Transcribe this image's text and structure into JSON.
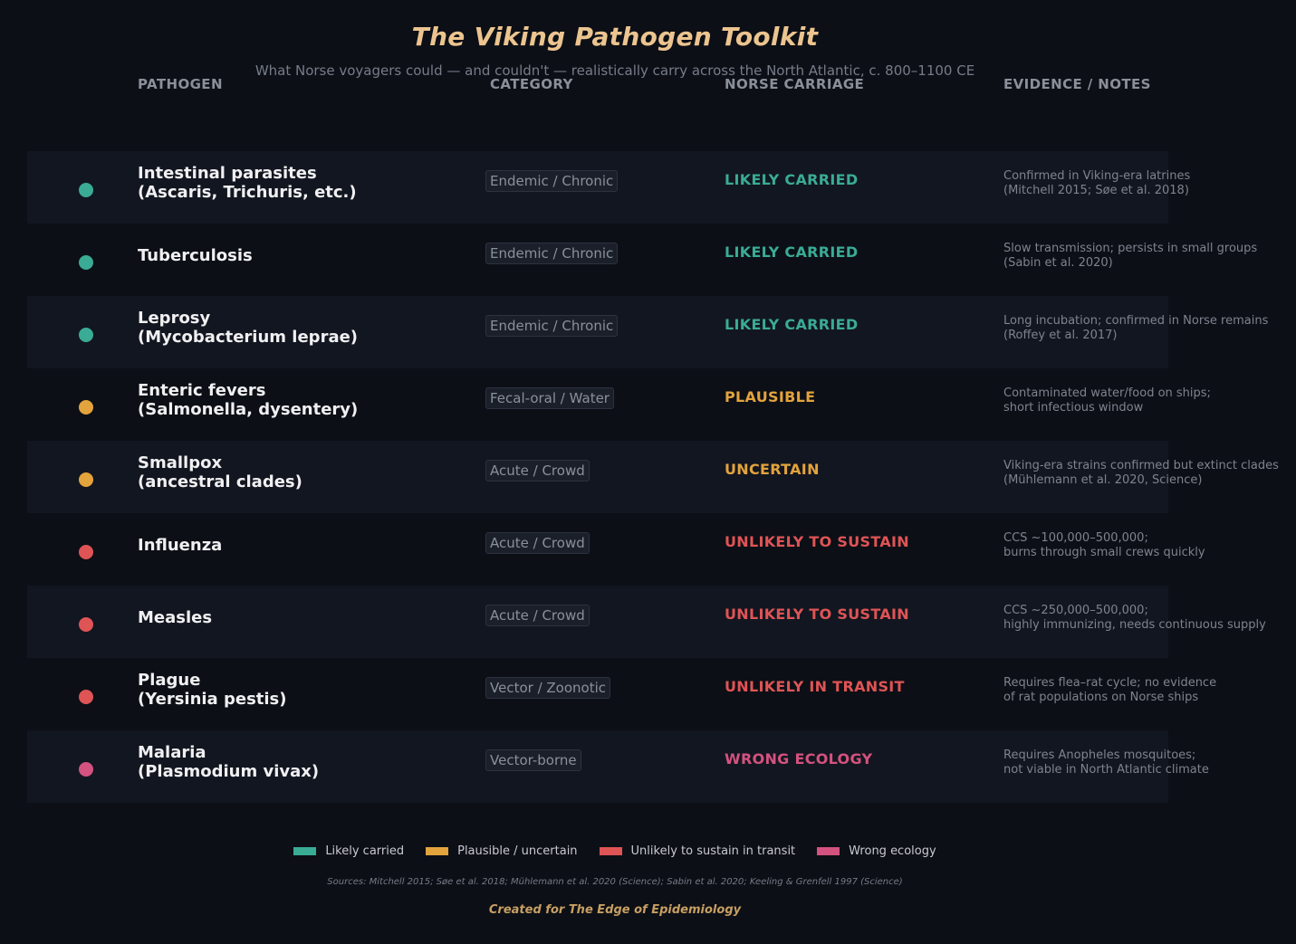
{
  "title": "The Viking Pathogen Toolkit",
  "subtitle": "What Norse voyagers could — and couldn't — realistically carry across the North Atlantic, c. 800–1100 CE",
  "columns": {
    "pathogen": "PATHOGEN",
    "category": "CATEGORY",
    "carriage": "NORSE CARRIAGE",
    "notes": "EVIDENCE / NOTES"
  },
  "colors": {
    "likely": "#3aab95",
    "plausible": "#e3a33d",
    "unlikely": "#df5455",
    "wrong": "#d4527f"
  },
  "rows": [
    {
      "name_line1": "Intestinal parasites",
      "name_line2": "(Ascaris, Trichuris, etc.)",
      "category": "Endemic / Chronic",
      "carriage": "LIKELY CARRIED",
      "status": "likely",
      "note_line1": "Confirmed in Viking-era latrines",
      "note_line2": "(Mitchell 2015; Søe et al. 2018)"
    },
    {
      "name_line1": "Tuberculosis",
      "name_line2": "",
      "category": "Endemic / Chronic",
      "carriage": "LIKELY CARRIED",
      "status": "likely",
      "note_line1": "Slow transmission; persists in small groups",
      "note_line2": "(Sabin et al. 2020)"
    },
    {
      "name_line1": "Leprosy",
      "name_line2": "(Mycobacterium leprae)",
      "category": "Endemic / Chronic",
      "carriage": "LIKELY CARRIED",
      "status": "likely",
      "note_line1": "Long incubation; confirmed in Norse remains",
      "note_line2": "(Roffey et al. 2017)"
    },
    {
      "name_line1": "Enteric fevers",
      "name_line2": "(Salmonella, dysentery)",
      "category": "Fecal-oral / Water",
      "carriage": "PLAUSIBLE",
      "status": "plausible",
      "note_line1": "Contaminated water/food on ships;",
      "note_line2": "short infectious window"
    },
    {
      "name_line1": "Smallpox",
      "name_line2": "(ancestral clades)",
      "category": "Acute / Crowd",
      "carriage": "UNCERTAIN",
      "status": "plausible",
      "note_line1": "Viking-era strains confirmed but extinct clades",
      "note_line2": "(Mühlemann et al. 2020, Science)"
    },
    {
      "name_line1": "Influenza",
      "name_line2": "",
      "category": "Acute / Crowd",
      "carriage": "UNLIKELY TO SUSTAIN",
      "status": "unlikely",
      "note_line1": "CCS ~100,000–500,000;",
      "note_line2": "burns through small crews quickly"
    },
    {
      "name_line1": "Measles",
      "name_line2": "",
      "category": "Acute / Crowd",
      "carriage": "UNLIKELY TO SUSTAIN",
      "status": "unlikely",
      "note_line1": "CCS ~250,000–500,000;",
      "note_line2": "highly immunizing, needs continuous supply"
    },
    {
      "name_line1": "Plague",
      "name_line2": "(Yersinia pestis)",
      "category": "Vector / Zoonotic",
      "carriage": "UNLIKELY IN TRANSIT",
      "status": "unlikely",
      "note_line1": "Requires flea–rat cycle; no evidence",
      "note_line2": "of rat populations on Norse ships"
    },
    {
      "name_line1": "Malaria",
      "name_line2": "(Plasmodium vivax)",
      "category": "Vector-borne",
      "carriage": "WRONG ECOLOGY",
      "status": "wrong",
      "note_line1": "Requires Anopheles mosquitoes;",
      "note_line2": "not viable in North Atlantic climate"
    }
  ],
  "legend": [
    {
      "label": "Likely carried",
      "status": "likely"
    },
    {
      "label": "Plausible / uncertain",
      "status": "plausible"
    },
    {
      "label": "Unlikely to sustain in transit",
      "status": "unlikely"
    },
    {
      "label": "Wrong ecology",
      "status": "wrong"
    }
  ],
  "sources": "Sources: Mitchell 2015; Søe et al. 2018; Mühlemann et al. 2020 (Science); Sabin et al. 2020; Keeling & Grenfell 1997 (Science)",
  "credit": "Created for The Edge of Epidemiology"
}
